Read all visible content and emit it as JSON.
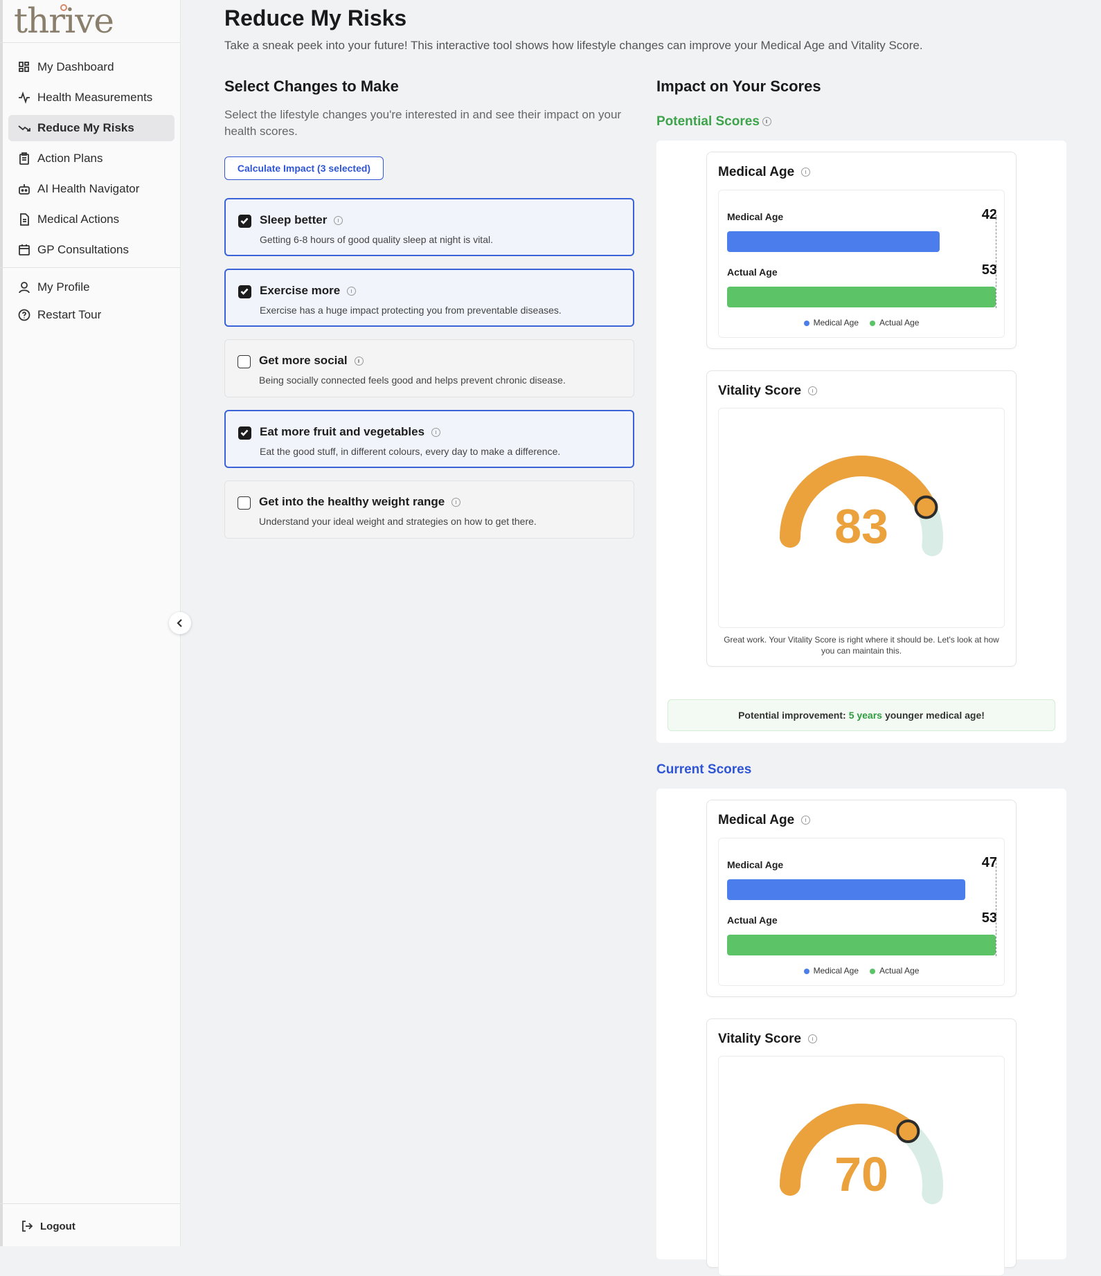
{
  "app": {
    "logo": "thrive"
  },
  "sidebar": {
    "items": [
      {
        "label": "My Dashboard",
        "icon": "dashboard-icon"
      },
      {
        "label": "Health Measurements",
        "icon": "activity-icon"
      },
      {
        "label": "Reduce My Risks",
        "icon": "trending-down-icon",
        "active": true
      },
      {
        "label": "Action Plans",
        "icon": "clipboard-icon"
      },
      {
        "label": "AI Health Navigator",
        "icon": "bot-icon"
      },
      {
        "label": "Medical Actions",
        "icon": "document-icon"
      },
      {
        "label": "GP Consultations",
        "icon": "calendar-icon"
      }
    ],
    "secondary": [
      {
        "label": "My Profile",
        "icon": "user-icon"
      },
      {
        "label": "Restart Tour",
        "icon": "help-circle-icon"
      }
    ],
    "logout": "Logout"
  },
  "page": {
    "title": "Reduce My Risks",
    "subtitle": "Take a sneak peek into your future! This interactive tool shows how lifestyle changes can improve your Medical Age and Vitality Score."
  },
  "changes": {
    "heading": "Select Changes to Make",
    "description": "Select the lifestyle changes you're interested in and see their impact on your health scores.",
    "calculate_label": "Calculate Impact (3 selected)",
    "items": [
      {
        "title": "Sleep better",
        "desc": "Getting 6-8 hours of good quality sleep at night is vital.",
        "checked": true
      },
      {
        "title": "Exercise more",
        "desc": "Exercise has a huge impact protecting you from preventable diseases.",
        "checked": true
      },
      {
        "title": "Get more social",
        "desc": "Being socially connected feels good and helps prevent chronic disease.",
        "checked": false
      },
      {
        "title": "Eat more fruit and vegetables",
        "desc": "Eat the good stuff, in different colours, every day to make a difference.",
        "checked": true
      },
      {
        "title": "Get into the healthy weight range",
        "desc": "Understand your ideal weight and strategies on how to get there.",
        "checked": false
      }
    ]
  },
  "impact": {
    "heading": "Impact on Your Scores",
    "potential": {
      "label": "Potential Scores",
      "label_color": "#3ea34a",
      "medical_age": {
        "title": "Medical Age",
        "medical_label": "Medical Age",
        "medical_value": "42",
        "medical_num": 42,
        "actual_label": "Actual Age",
        "actual_value": "53",
        "actual_num": 53,
        "legend_medical": "Medical Age",
        "legend_actual": "Actual Age"
      },
      "vitality": {
        "title": "Vitality Score",
        "score": "83",
        "score_num": 83,
        "note": "Great work. Your Vitality Score is right where it should be. Let's look at how you can maintain this."
      },
      "improvement": {
        "prefix": "Potential improvement:",
        "highlight": "5 years",
        "suffix": "younger medical age!"
      }
    },
    "current": {
      "label": "Current Scores",
      "label_color": "#2f55d4",
      "medical_age": {
        "title": "Medical Age",
        "medical_label": "Medical Age",
        "medical_value": "47",
        "medical_num": 47,
        "actual_label": "Actual Age",
        "actual_value": "53",
        "actual_num": 53,
        "legend_medical": "Medical Age",
        "legend_actual": "Actual Age"
      },
      "vitality": {
        "title": "Vitality Score",
        "score": "70",
        "score_num": 70
      }
    }
  },
  "colors": {
    "accent_blue": "#2f55d4",
    "bar_blue": "#4c7ded",
    "bar_green": "#5cc367",
    "gauge_orange": "#eba13c",
    "gauge_track": "#d9ede6"
  }
}
